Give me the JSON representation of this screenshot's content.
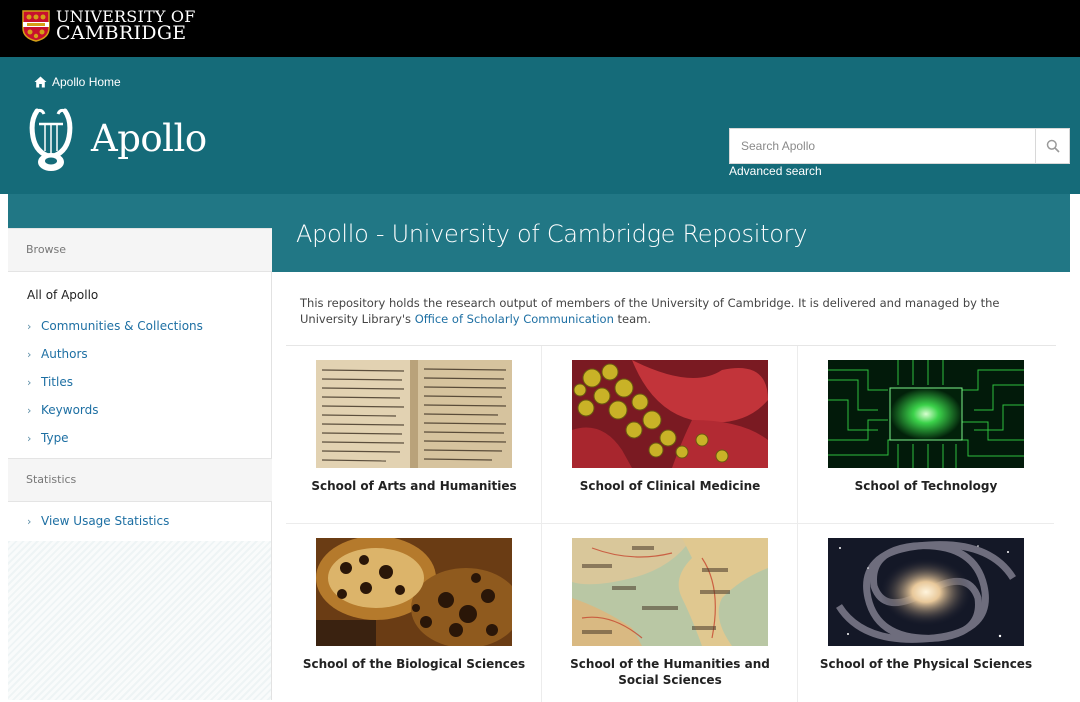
{
  "university": {
    "line1": "UNIVERSITY OF",
    "line2": "CAMBRIDGE"
  },
  "header": {
    "home_link": "Apollo Home",
    "brand": "Apollo",
    "search": {
      "placeholder": "Search Apollo"
    },
    "advanced_search": "Advanced search"
  },
  "page": {
    "title": "Apollo - University of Cambridge Repository"
  },
  "sidebar": {
    "browse_heading": "Browse",
    "all_label": "All of Apollo",
    "browse_items": [
      {
        "label": "Communities & Collections"
      },
      {
        "label": "Authors"
      },
      {
        "label": "Titles"
      },
      {
        "label": "Keywords"
      },
      {
        "label": "Type"
      }
    ],
    "statistics_heading": "Statistics",
    "statistics_items": [
      {
        "label": "View Usage Statistics"
      }
    ]
  },
  "intro": {
    "text_before": "This repository holds the research output of members of the University of Cambridge. It is delivered and managed by the University Library's ",
    "link": "Office of Scholarly Communication",
    "text_after": " team."
  },
  "schools": [
    {
      "label": "School of Arts and Humanities",
      "image": "manuscript"
    },
    {
      "label": "School of Clinical Medicine",
      "image": "bacteria-cells"
    },
    {
      "label": "School of Technology",
      "image": "circuit-board"
    },
    {
      "label": "School of the Biological Sciences",
      "image": "cell-tissue"
    },
    {
      "label": "School of the Humanities and Social Sciences",
      "image": "map"
    },
    {
      "label": "School of the Physical Sciences",
      "image": "galaxy"
    }
  ],
  "colors": {
    "header": "#156b79",
    "title_band": "#217785",
    "link": "#1d6fa3"
  }
}
